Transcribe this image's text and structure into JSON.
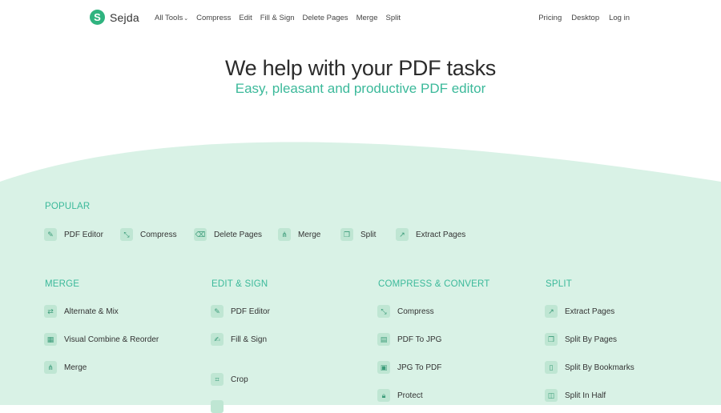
{
  "header": {
    "brand": "Sejda",
    "logo_letter": "S",
    "nav_left": [
      "All Tools",
      "Compress",
      "Edit",
      "Fill & Sign",
      "Delete Pages",
      "Merge",
      "Split"
    ],
    "nav_right": [
      "Pricing",
      "Desktop",
      "Log in"
    ]
  },
  "hero": {
    "title": "We help with your PDF tasks",
    "subtitle": "Easy, pleasant and productive PDF editor"
  },
  "popular": {
    "title": "POPULAR",
    "items": [
      {
        "label": "PDF Editor",
        "icon": "pencil-icon"
      },
      {
        "label": "Compress",
        "icon": "compress-icon"
      },
      {
        "label": "Delete Pages",
        "icon": "trash-icon"
      },
      {
        "label": "Merge",
        "icon": "merge-icon"
      },
      {
        "label": "Split",
        "icon": "split-icon"
      },
      {
        "label": "Extract Pages",
        "icon": "extract-icon"
      }
    ]
  },
  "columns": [
    {
      "title": "MERGE",
      "items": [
        {
          "label": "Alternate & Mix",
          "icon": "shuffle-icon"
        },
        {
          "label": "Visual Combine & Reorder",
          "icon": "combine-icon"
        },
        {
          "label": "Merge",
          "icon": "merge-icon"
        }
      ]
    },
    {
      "title": "EDIT & SIGN",
      "items": [
        {
          "label": "PDF Editor",
          "icon": "pencil-icon"
        },
        {
          "label": "Fill & Sign",
          "icon": "sign-icon"
        },
        {
          "label": "Crop",
          "icon": "crop-icon"
        }
      ]
    },
    {
      "title": "COMPRESS & CONVERT",
      "items": [
        {
          "label": "Compress",
          "icon": "compress-icon"
        },
        {
          "label": "PDF To JPG",
          "icon": "document-icon"
        },
        {
          "label": "JPG To PDF",
          "icon": "image-icon"
        },
        {
          "label": "Protect",
          "icon": "lock-icon"
        }
      ]
    },
    {
      "title": "SPLIT",
      "items": [
        {
          "label": "Extract Pages",
          "icon": "extract-icon"
        },
        {
          "label": "Split By Pages",
          "icon": "split-icon"
        },
        {
          "label": "Split By Bookmarks",
          "icon": "bookmark-icon"
        },
        {
          "label": "Split In Half",
          "icon": "half-icon"
        }
      ]
    }
  ]
}
